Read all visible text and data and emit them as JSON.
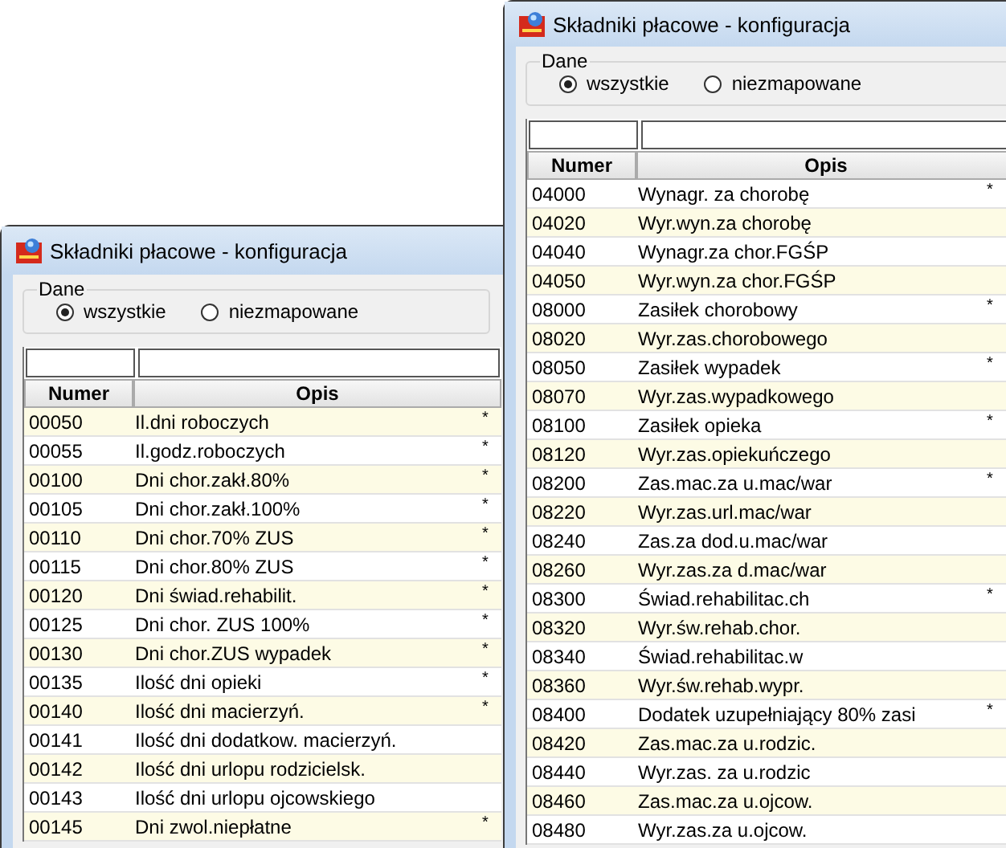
{
  "windows": [
    {
      "title": "Składniki płacowe - konfiguracja",
      "group": {
        "label": "Dane",
        "options": [
          {
            "label": "wszystkie",
            "selected": true
          },
          {
            "label": "niezmapowane",
            "selected": false
          }
        ]
      },
      "table": {
        "columns": [
          "Numer",
          "Opis"
        ],
        "rows": [
          {
            "numer": "00050",
            "opis": "Il.dni roboczych",
            "flag": "*",
            "shaded": true
          },
          {
            "numer": "00055",
            "opis": "Il.godz.roboczych",
            "flag": "*",
            "shaded": false
          },
          {
            "numer": "00100",
            "opis": "Dni chor.zakł.80%",
            "flag": "*",
            "shaded": true
          },
          {
            "numer": "00105",
            "opis": "Dni chor.zakł.100%",
            "flag": "*",
            "shaded": false
          },
          {
            "numer": "00110",
            "opis": "Dni chor.70% ZUS",
            "flag": "*",
            "shaded": true
          },
          {
            "numer": "00115",
            "opis": "Dni chor.80% ZUS",
            "flag": "*",
            "shaded": false
          },
          {
            "numer": "00120",
            "opis": "Dni świad.rehabilit.",
            "flag": "*",
            "shaded": true
          },
          {
            "numer": "00125",
            "opis": "Dni chor. ZUS  100%",
            "flag": "*",
            "shaded": false
          },
          {
            "numer": "00130",
            "opis": "Dni chor.ZUS wypadek",
            "flag": "*",
            "shaded": true
          },
          {
            "numer": "00135",
            "opis": "Ilość dni opieki",
            "flag": "*",
            "shaded": false
          },
          {
            "numer": "00140",
            "opis": "Ilość dni macierzyń.",
            "flag": "*",
            "shaded": true
          },
          {
            "numer": "00141",
            "opis": "Ilość dni dodatkow. macierzyń.",
            "shaded": false
          },
          {
            "numer": "00142",
            "opis": "Ilość dni urlopu rodzicielsk.",
            "shaded": true
          },
          {
            "numer": "00143",
            "opis": "Ilość dni urlopu ojcowskiego",
            "shaded": false
          },
          {
            "numer": "00145",
            "opis": "Dni zwol.niepłatne",
            "flag": "*",
            "shaded": true
          }
        ]
      }
    },
    {
      "title": "Składniki płacowe - konfiguracja",
      "group": {
        "label": "Dane",
        "options": [
          {
            "label": "wszystkie",
            "selected": true
          },
          {
            "label": "niezmapowane",
            "selected": false
          }
        ]
      },
      "table": {
        "columns": [
          "Numer",
          "Opis"
        ],
        "rows": [
          {
            "numer": "04000",
            "opis": "Wynagr. za chorobę",
            "flag": "*",
            "shaded": false
          },
          {
            "numer": "04020",
            "opis": "Wyr.wyn.za chorobę",
            "shaded": true
          },
          {
            "numer": "04040",
            "opis": "Wynagr.za chor.FGŚP",
            "shaded": false
          },
          {
            "numer": "04050",
            "opis": "Wyr.wyn.za chor.FGŚP",
            "shaded": true
          },
          {
            "numer": "08000",
            "opis": "Zasiłek chorobowy",
            "flag": "*",
            "shaded": false
          },
          {
            "numer": "08020",
            "opis": "Wyr.zas.chorobowego",
            "shaded": true
          },
          {
            "numer": "08050",
            "opis": "Zasiłek wypadek",
            "flag": "*",
            "shaded": false
          },
          {
            "numer": "08070",
            "opis": "Wyr.zas.wypadkowego",
            "shaded": true
          },
          {
            "numer": "08100",
            "opis": "Zasiłek opieka",
            "flag": "*",
            "shaded": false
          },
          {
            "numer": "08120",
            "opis": "Wyr.zas.opiekuńczego",
            "shaded": true
          },
          {
            "numer": "08200",
            "opis": "Zas.mac.za u.mac/war",
            "flag": "*",
            "shaded": false
          },
          {
            "numer": "08220",
            "opis": "Wyr.zas.url.mac/war",
            "shaded": true
          },
          {
            "numer": "08240",
            "opis": "Zas.za dod.u.mac/war",
            "shaded": false
          },
          {
            "numer": "08260",
            "opis": "Wyr.zas.za d.mac/war",
            "shaded": true
          },
          {
            "numer": "08300",
            "opis": "Świad.rehabilitac.ch",
            "flag": "*",
            "shaded": false
          },
          {
            "numer": "08320",
            "opis": "Wyr.św.rehab.chor.",
            "shaded": true
          },
          {
            "numer": "08340",
            "opis": "Świad.rehabilitac.w",
            "shaded": false
          },
          {
            "numer": "08360",
            "opis": "Wyr.św.rehab.wypr.",
            "shaded": true
          },
          {
            "numer": "08400",
            "opis": "Dodatek uzupełniający 80% zasi",
            "flag": "*",
            "shaded": false
          },
          {
            "numer": "08420",
            "opis": "Zas.mac.za u.rodzic.",
            "shaded": true
          },
          {
            "numer": "08440",
            "opis": "Wyr.zas. za u.rodzic",
            "shaded": false
          },
          {
            "numer": "08460",
            "opis": "Zas.mac.za u.ojcow.",
            "shaded": true
          },
          {
            "numer": "08480",
            "opis": "Wyr.zas.za u.ojcow.",
            "shaded": false
          }
        ]
      }
    }
  ]
}
